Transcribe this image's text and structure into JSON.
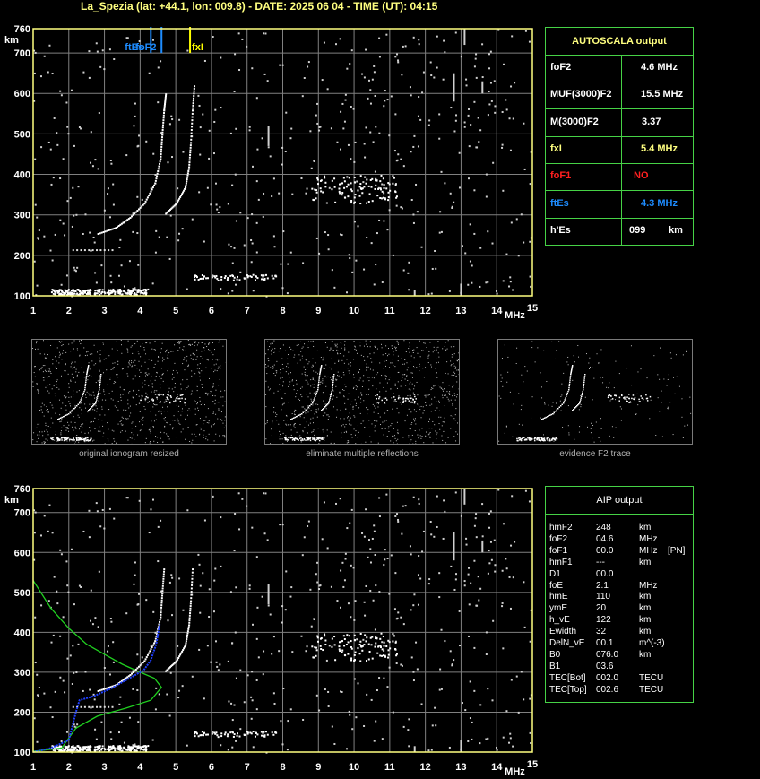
{
  "title": "La_Spezia (lat: +44.1, lon: 009.8) - DATE: 2025 06 04 - TIME (UT): 04:15",
  "colors": {
    "grid": "#808080",
    "axis": "#ffff80",
    "panel_border": "#46d246",
    "fof2": "#1e8cff",
    "fxl": "#ffff00",
    "fof1": "#ff2020",
    "ftes": "#1e8cff",
    "profile_green": "#20d020",
    "profile_blue": "#2040ff"
  },
  "autoscala": {
    "title": "AUTOSCALA output",
    "rows": [
      {
        "label": "foF2",
        "value": "4.6 MHz",
        "color": "#ffffff"
      },
      {
        "label": "MUF(3000)F2",
        "value": "15.5 MHz",
        "color": "#ffffff"
      },
      {
        "label": "M(3000)F2",
        "value": "3.37",
        "color": "#ffffff"
      },
      {
        "label": "fxI",
        "value": "5.4 MHz",
        "color": "#ffff80"
      },
      {
        "label": "foF1",
        "value": "NO",
        "color": "#ff2020"
      },
      {
        "label": "ftEs",
        "value": "4.3 MHz",
        "color": "#1e8cff"
      },
      {
        "label": "h'Es",
        "value": "099",
        "unit": "km",
        "color": "#ffffff"
      }
    ]
  },
  "aip": {
    "title": "AIP output",
    "rows": [
      {
        "name": "hmF2",
        "value": "248",
        "unit": "km",
        "extra": ""
      },
      {
        "name": "foF2",
        "value": "04.6",
        "unit": "MHz",
        "extra": ""
      },
      {
        "name": "foF1",
        "value": "00.0",
        "unit": "MHz",
        "extra": "[PN]"
      },
      {
        "name": "hmF1",
        "value": "---",
        "unit": "km",
        "extra": ""
      },
      {
        "name": "D1",
        "value": "00.0",
        "unit": "",
        "extra": ""
      },
      {
        "name": "foE",
        "value": "2.1",
        "unit": "MHz",
        "extra": ""
      },
      {
        "name": "hmE",
        "value": "110",
        "unit": "km",
        "extra": ""
      },
      {
        "name": "ymE",
        "value": "20",
        "unit": "km",
        "extra": ""
      },
      {
        "name": "h_vE",
        "value": "122",
        "unit": "km",
        "extra": ""
      },
      {
        "name": "Ewidth",
        "value": "32",
        "unit": "km",
        "extra": ""
      },
      {
        "name": "DelN_vE",
        "value": "00.1",
        "unit": "m^(-3)",
        "extra": ""
      },
      {
        "name": "B0",
        "value": "076.0",
        "unit": "km",
        "extra": ""
      },
      {
        "name": "B1",
        "value": "03.6",
        "unit": "",
        "extra": ""
      },
      {
        "name": "TEC[Bot]",
        "value": "002.0",
        "unit": "TECU",
        "extra": ""
      },
      {
        "name": "TEC[Top]",
        "value": "002.6",
        "unit": "TECU",
        "extra": ""
      }
    ]
  },
  "captions": [
    "original ionogram resized",
    "eliminate multiple reflections",
    "evidence F2 trace"
  ],
  "chart_data": [
    {
      "type": "scatter",
      "name": "ionogram-top",
      "xlabel": "MHz",
      "ylabel": "km",
      "xlim": [
        1,
        15
      ],
      "ylim": [
        100,
        760
      ],
      "xticks": [
        1,
        2,
        3,
        4,
        5,
        6,
        7,
        8,
        9,
        10,
        11,
        12,
        13,
        14,
        15
      ],
      "yticks": [
        100,
        200,
        300,
        400,
        500,
        600,
        700,
        760
      ],
      "grid": true,
      "markers": [
        {
          "label": "ftEs",
          "x": 4.3,
          "color": "#1e8cff"
        },
        {
          "label": "foF2",
          "x": 4.6,
          "color": "#1e8cff"
        },
        {
          "label": "fxI",
          "x": 5.4,
          "color": "#ffff00"
        }
      ],
      "traces": {
        "o_trace": [
          [
            2.8,
            255
          ],
          [
            3.3,
            270
          ],
          [
            3.7,
            295
          ],
          [
            4.1,
            330
          ],
          [
            4.4,
            380
          ],
          [
            4.55,
            440
          ],
          [
            4.6,
            500
          ],
          [
            4.65,
            560
          ],
          [
            4.7,
            600
          ]
        ],
        "x_trace": [
          [
            4.7,
            305
          ],
          [
            5.0,
            330
          ],
          [
            5.25,
            370
          ],
          [
            5.35,
            420
          ],
          [
            5.4,
            480
          ],
          [
            5.45,
            560
          ],
          [
            5.5,
            620
          ]
        ],
        "es_layer": [
          [
            1.5,
            112
          ],
          [
            2.0,
            113
          ],
          [
            2.5,
            113
          ],
          [
            3.0,
            112
          ],
          [
            3.5,
            113
          ],
          [
            4.0,
            112
          ]
        ]
      }
    },
    {
      "type": "scatter",
      "name": "ionogram-bottom",
      "xlabel": "MHz",
      "ylabel": "km",
      "xlim": [
        1,
        15
      ],
      "ylim": [
        100,
        760
      ],
      "xticks": [
        1,
        2,
        3,
        4,
        5,
        6,
        7,
        8,
        9,
        10,
        11,
        12,
        13,
        14,
        15
      ],
      "yticks": [
        100,
        200,
        300,
        400,
        500,
        600,
        700,
        760
      ],
      "grid": true,
      "profile_green": [
        [
          1.0,
          530
        ],
        [
          1.5,
          460
        ],
        [
          2.0,
          410
        ],
        [
          2.5,
          370
        ],
        [
          3.0,
          345
        ],
        [
          3.5,
          320
        ],
        [
          4.0,
          300
        ],
        [
          4.4,
          285
        ],
        [
          4.6,
          262
        ],
        [
          4.3,
          230
        ],
        [
          3.6,
          210
        ],
        [
          2.8,
          190
        ],
        [
          2.2,
          160
        ],
        [
          2.0,
          135
        ],
        [
          1.8,
          110
        ],
        [
          1.0,
          102
        ]
      ],
      "profile_blue": [
        [
          1.0,
          100
        ],
        [
          1.5,
          110
        ],
        [
          2.0,
          130
        ],
        [
          2.2,
          200
        ],
        [
          2.3,
          230
        ],
        [
          2.7,
          240
        ],
        [
          3.2,
          260
        ],
        [
          3.7,
          285
        ],
        [
          4.1,
          305
        ],
        [
          4.3,
          330
        ],
        [
          4.45,
          370
        ],
        [
          4.55,
          420
        ]
      ]
    }
  ]
}
